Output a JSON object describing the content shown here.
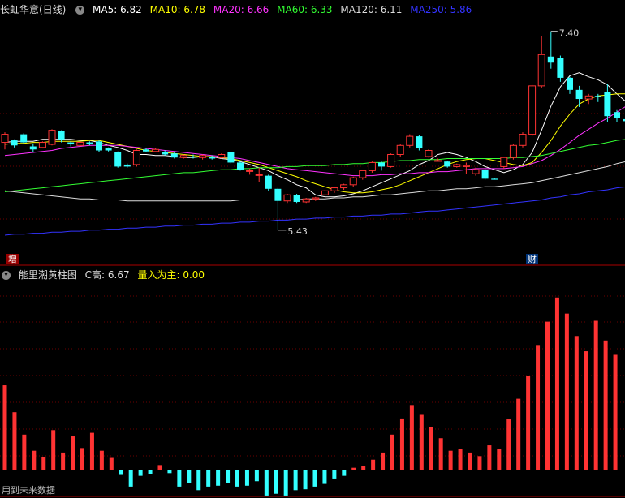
{
  "header": {
    "title": "长虹华意(日线)",
    "ma": [
      {
        "label": "MA5: 6.82",
        "color": "#ffffff"
      },
      {
        "label": "MA10: 6.78",
        "color": "#ffff00"
      },
      {
        "label": "MA20: 6.66",
        "color": "#ff33ff"
      },
      {
        "label": "MA60: 6.33",
        "color": "#33ff33"
      },
      {
        "label": "MA120: 6.11",
        "color": "#dddddd"
      },
      {
        "label": "MA250: 5.86",
        "color": "#3333ff"
      }
    ]
  },
  "markers": {
    "high_label": "7.40",
    "low_label": "5.43",
    "tag_left": "增",
    "tag_right": "财"
  },
  "indicator": {
    "title": "能里潮黄柱图",
    "c_high": "C高: 6.67",
    "main_label": "量入为主: 0.00",
    "main_color": "#ffff00"
  },
  "footnote": "用到未来数据",
  "colors": {
    "up": "#ff3333",
    "down": "#33ffff",
    "bg": "#000000",
    "grid": "#6b0000"
  },
  "chart_data": {
    "type": "candlestick",
    "candles": [
      [
        6.3,
        6.38,
        6.23,
        6.4
      ],
      [
        6.32,
        6.27,
        6.25,
        6.33
      ],
      [
        6.38,
        6.3,
        6.28,
        6.39
      ],
      [
        6.26,
        6.23,
        6.2,
        6.29
      ],
      [
        6.25,
        6.3,
        6.24,
        6.31
      ],
      [
        6.28,
        6.42,
        6.27,
        6.43
      ],
      [
        6.41,
        6.33,
        6.3,
        6.42
      ],
      [
        6.3,
        6.28,
        6.26,
        6.31
      ],
      [
        6.27,
        6.3,
        6.26,
        6.31
      ],
      [
        6.3,
        6.28,
        6.27,
        6.31
      ],
      [
        6.31,
        6.22,
        6.2,
        6.32
      ],
      [
        6.24,
        6.22,
        6.21,
        6.25
      ],
      [
        6.2,
        6.06,
        6.05,
        6.21
      ],
      [
        6.08,
        6.06,
        6.05,
        6.09
      ],
      [
        6.08,
        6.22,
        6.06,
        6.23
      ],
      [
        6.23,
        6.21,
        6.2,
        6.24
      ],
      [
        6.21,
        6.23,
        6.2,
        6.24
      ],
      [
        6.2,
        6.18,
        6.17,
        6.22
      ],
      [
        6.19,
        6.15,
        6.14,
        6.2
      ],
      [
        6.15,
        6.17,
        6.14,
        6.18
      ],
      [
        6.16,
        6.15,
        6.14,
        6.18
      ],
      [
        6.15,
        6.17,
        6.13,
        6.18
      ],
      [
        6.16,
        6.14,
        6.13,
        6.17
      ],
      [
        6.15,
        6.18,
        6.14,
        6.19
      ],
      [
        6.2,
        6.1,
        6.09,
        6.2
      ],
      [
        6.1,
        6.03,
        6.02,
        6.11
      ],
      [
        6.02,
        6.02,
        5.98,
        6.04
      ],
      [
        5.98,
        5.98,
        5.91,
        6.05
      ],
      [
        5.97,
        5.84,
        5.82,
        5.98
      ],
      [
        5.84,
        5.72,
        5.43,
        5.85
      ],
      [
        5.72,
        5.78,
        5.7,
        5.79
      ],
      [
        5.78,
        5.71,
        5.7,
        5.79
      ],
      [
        5.71,
        5.74,
        5.7,
        5.75
      ],
      [
        5.74,
        5.75,
        5.72,
        5.76
      ],
      [
        5.78,
        5.82,
        5.76,
        5.83
      ],
      [
        5.82,
        5.85,
        5.8,
        5.86
      ],
      [
        5.85,
        5.88,
        5.83,
        5.89
      ],
      [
        5.88,
        5.95,
        5.86,
        5.96
      ],
      [
        5.95,
        6.02,
        5.93,
        6.03
      ],
      [
        6.02,
        6.1,
        6.0,
        6.11
      ],
      [
        6.1,
        6.06,
        6.02,
        6.11
      ],
      [
        6.06,
        6.18,
        6.05,
        6.19
      ],
      [
        6.18,
        6.27,
        6.16,
        6.28
      ],
      [
        6.27,
        6.36,
        6.25,
        6.38
      ],
      [
        6.36,
        6.24,
        6.22,
        6.37
      ],
      [
        6.16,
        6.22,
        6.15,
        6.23
      ],
      [
        6.12,
        6.12,
        6.11,
        6.14
      ],
      [
        6.11,
        6.06,
        6.05,
        6.12
      ],
      [
        6.06,
        6.08,
        6.05,
        6.09
      ],
      [
        6.06,
        6.07,
        5.99,
        6.1
      ],
      [
        5.99,
        6.03,
        5.97,
        6.05
      ],
      [
        6.03,
        5.94,
        5.93,
        6.04
      ],
      [
        5.94,
        5.93,
        5.93,
        5.95
      ],
      [
        6.06,
        6.15,
        6.04,
        6.16
      ],
      [
        6.15,
        6.27,
        6.13,
        6.28
      ],
      [
        6.27,
        6.38,
        6.25,
        6.4
      ],
      [
        6.38,
        6.86,
        6.36,
        6.87
      ],
      [
        6.86,
        7.17,
        6.84,
        7.35
      ],
      [
        7.15,
        7.09,
        7.03,
        7.4
      ],
      [
        7.14,
        6.94,
        6.9,
        7.16
      ],
      [
        6.94,
        6.82,
        6.78,
        6.95
      ],
      [
        6.82,
        6.73,
        6.65,
        6.86
      ],
      [
        6.73,
        6.76,
        6.68,
        6.78
      ],
      [
        6.76,
        6.75,
        6.7,
        6.78
      ],
      [
        6.8,
        6.56,
        6.5,
        6.88
      ],
      [
        6.6,
        6.54,
        6.5,
        6.62
      ],
      [
        6.53,
        6.51,
        6.48,
        6.55
      ]
    ],
    "ma_series": [
      {
        "name": "MA5",
        "values": [
          6.3,
          6.31,
          6.31,
          6.31,
          6.33,
          6.33,
          6.33,
          6.33,
          6.32,
          6.32,
          6.3,
          6.27,
          6.25,
          6.22,
          6.18,
          6.18,
          6.17,
          6.17,
          6.16,
          6.15,
          6.15,
          6.16,
          6.16,
          6.14,
          6.13,
          6.11,
          6.08,
          6.05,
          6.02,
          5.97,
          5.93,
          5.88,
          5.85,
          5.78,
          5.76,
          5.76,
          5.77,
          5.79,
          5.82,
          5.86,
          5.9,
          5.94,
          5.98,
          6.02,
          6.08,
          6.12,
          6.18,
          6.2,
          6.18,
          6.15,
          6.11,
          6.06,
          6.03,
          6.0,
          6.03,
          6.08,
          6.2,
          6.42,
          6.66,
          6.85,
          6.96,
          6.99,
          6.95,
          6.92,
          6.87,
          6.78,
          6.7
        ]
      },
      {
        "name": "MA10",
        "values": [
          6.28,
          6.29,
          6.29,
          6.3,
          6.3,
          6.31,
          6.31,
          6.31,
          6.31,
          6.32,
          6.32,
          6.3,
          6.28,
          6.26,
          6.24,
          6.22,
          6.21,
          6.2,
          6.19,
          6.18,
          6.17,
          6.16,
          6.16,
          6.15,
          6.14,
          6.12,
          6.1,
          6.08,
          6.05,
          6.02,
          5.99,
          5.96,
          5.92,
          5.89,
          5.86,
          5.83,
          5.81,
          5.8,
          5.8,
          5.81,
          5.83,
          5.85,
          5.88,
          5.92,
          5.96,
          6.0,
          6.04,
          6.08,
          6.11,
          6.13,
          6.14,
          6.14,
          6.12,
          6.1,
          6.08,
          6.07,
          6.1,
          6.2,
          6.32,
          6.46,
          6.58,
          6.68,
          6.73,
          6.76,
          6.77,
          6.78,
          6.78
        ]
      },
      {
        "name": "MA20",
        "values": [
          6.17,
          6.18,
          6.19,
          6.2,
          6.21,
          6.22,
          6.24,
          6.25,
          6.26,
          6.27,
          6.27,
          6.27,
          6.27,
          6.26,
          6.25,
          6.24,
          6.23,
          6.22,
          6.21,
          6.2,
          6.19,
          6.18,
          6.17,
          6.16,
          6.15,
          6.14,
          6.12,
          6.1,
          6.08,
          6.06,
          6.04,
          6.03,
          6.02,
          6.01,
          6.0,
          5.99,
          5.98,
          5.97,
          5.97,
          5.97,
          5.98,
          5.98,
          5.99,
          5.99,
          6.0,
          6.0,
          6.01,
          6.01,
          6.02,
          6.03,
          6.04,
          6.04,
          6.04,
          6.04,
          6.05,
          6.06,
          6.09,
          6.12,
          6.17,
          6.23,
          6.3,
          6.37,
          6.43,
          6.49,
          6.54,
          6.6,
          6.66
        ]
      },
      {
        "name": "MA60",
        "values": [
          5.81,
          5.82,
          5.83,
          5.84,
          5.85,
          5.86,
          5.87,
          5.88,
          5.89,
          5.9,
          5.91,
          5.92,
          5.93,
          5.94,
          5.95,
          5.96,
          5.97,
          5.98,
          5.99,
          6.0,
          6.0,
          6.01,
          6.02,
          6.03,
          6.03,
          6.04,
          6.04,
          6.05,
          6.05,
          6.05,
          6.06,
          6.06,
          6.07,
          6.07,
          6.07,
          6.08,
          6.08,
          6.09,
          6.09,
          6.1,
          6.1,
          6.11,
          6.12,
          6.12,
          6.13,
          6.13,
          6.13,
          6.14,
          6.14,
          6.14,
          6.14,
          6.14,
          6.14,
          6.14,
          6.15,
          6.15,
          6.16,
          6.17,
          6.19,
          6.21,
          6.23,
          6.25,
          6.27,
          6.28,
          6.3,
          6.32,
          6.33
        ]
      },
      {
        "name": "MA120",
        "values": [
          5.82,
          5.81,
          5.8,
          5.79,
          5.78,
          5.77,
          5.76,
          5.75,
          5.74,
          5.74,
          5.73,
          5.73,
          5.73,
          5.72,
          5.72,
          5.72,
          5.72,
          5.72,
          5.72,
          5.72,
          5.72,
          5.72,
          5.72,
          5.72,
          5.72,
          5.73,
          5.73,
          5.73,
          5.73,
          5.73,
          5.73,
          5.73,
          5.74,
          5.74,
          5.74,
          5.75,
          5.75,
          5.76,
          5.76,
          5.77,
          5.78,
          5.78,
          5.79,
          5.8,
          5.81,
          5.82,
          5.82,
          5.83,
          5.84,
          5.84,
          5.85,
          5.86,
          5.86,
          5.87,
          5.88,
          5.89,
          5.9,
          5.92,
          5.94,
          5.96,
          5.98,
          6.0,
          6.02,
          6.04,
          6.06,
          6.09,
          6.11
        ]
      },
      {
        "name": "MA250",
        "values": [
          5.38,
          5.39,
          5.39,
          5.4,
          5.4,
          5.41,
          5.41,
          5.42,
          5.42,
          5.43,
          5.43,
          5.44,
          5.44,
          5.45,
          5.45,
          5.46,
          5.46,
          5.47,
          5.47,
          5.48,
          5.48,
          5.49,
          5.49,
          5.5,
          5.5,
          5.51,
          5.51,
          5.52,
          5.52,
          5.53,
          5.53,
          5.54,
          5.54,
          5.55,
          5.55,
          5.56,
          5.56,
          5.57,
          5.57,
          5.58,
          5.58,
          5.59,
          5.59,
          5.6,
          5.61,
          5.62,
          5.62,
          5.63,
          5.64,
          5.65,
          5.66,
          5.67,
          5.68,
          5.69,
          5.7,
          5.71,
          5.72,
          5.73,
          5.75,
          5.76,
          5.78,
          5.79,
          5.81,
          5.82,
          5.83,
          5.85,
          5.86
        ]
      }
    ],
    "ylim": [
      5.3,
      7.55
    ],
    "indicator_bars": [
      95,
      65,
      40,
      22,
      15,
      45,
      20,
      38,
      25,
      42,
      22,
      14,
      -5,
      -18,
      -6,
      -4,
      6,
      -3,
      -18,
      -14,
      -22,
      -18,
      -17,
      -14,
      -18,
      -17,
      -12,
      -28,
      -26,
      -28,
      -22,
      -21,
      -18,
      -15,
      -9,
      -6,
      3,
      5,
      12,
      20,
      40,
      58,
      73,
      62,
      48,
      36,
      22,
      24,
      20,
      16,
      28,
      24,
      57,
      80,
      105,
      140,
      166,
      193,
      175,
      150,
      133,
      167,
      145,
      129
    ],
    "indicator_ylim": [
      -30,
      210
    ]
  }
}
